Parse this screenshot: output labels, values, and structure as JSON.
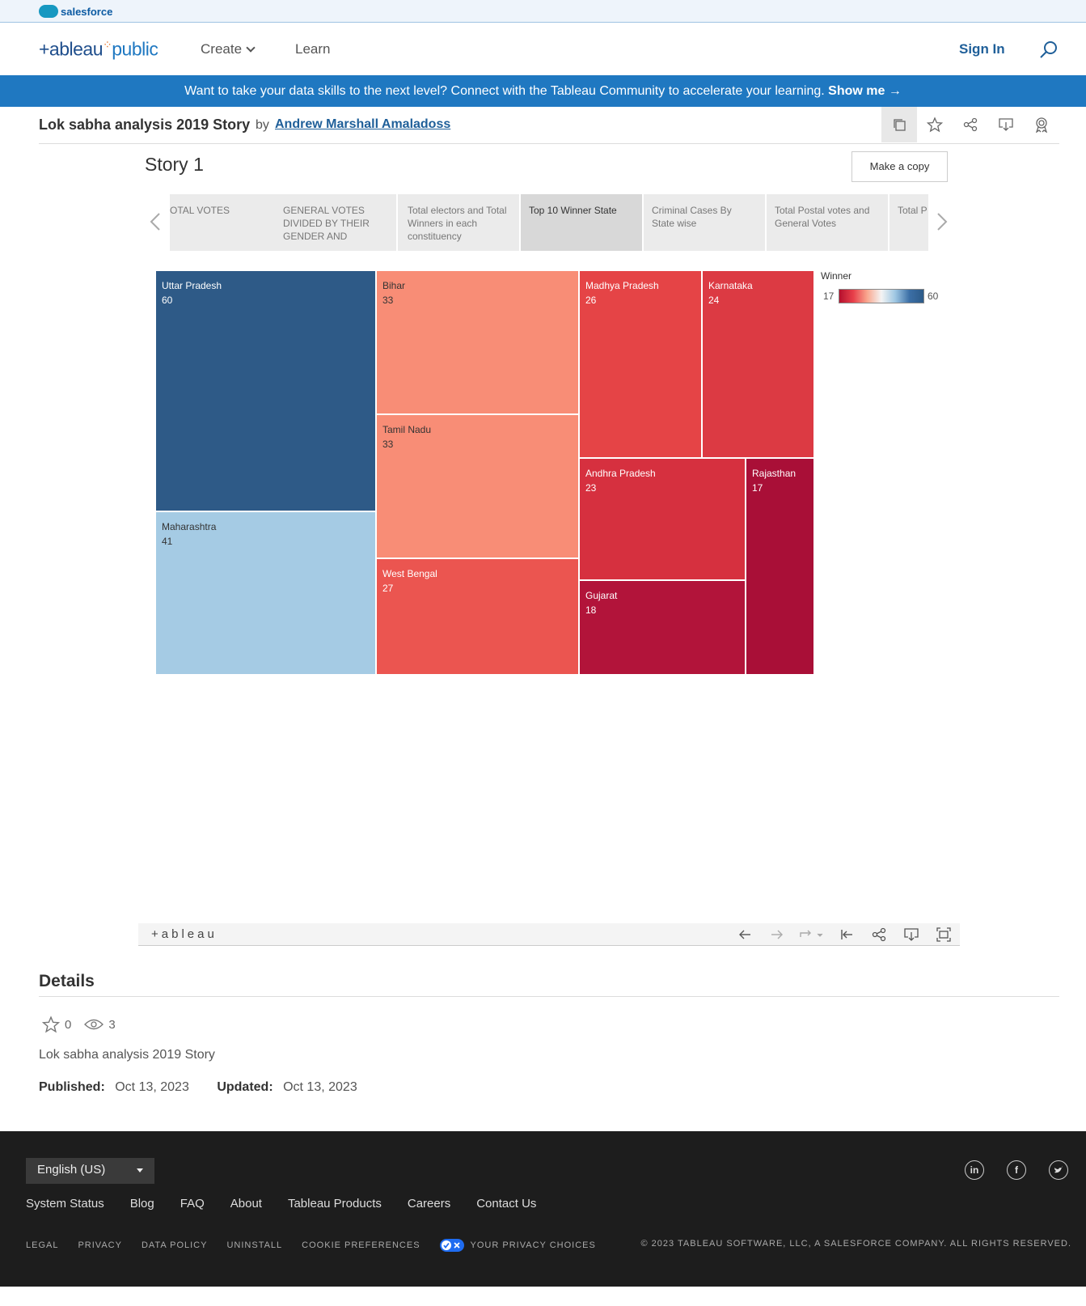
{
  "salesforce": {
    "brand": "salesforce"
  },
  "header": {
    "logo_prefix": "+ableau",
    "logo_suffix": "public",
    "nav": [
      {
        "label": "Create"
      },
      {
        "label": "Learn"
      }
    ],
    "sign_in": "Sign In"
  },
  "banner": {
    "text": "Want to take your data skills to the next level? Connect with the Tableau Community to accelerate your learning.",
    "cta": "Show me →"
  },
  "viz": {
    "title": "Lok sabha analysis 2019 Story",
    "by": "by",
    "author": "Andrew Marshall Amaladoss"
  },
  "story": {
    "title": "Story 1",
    "make_copy": "Make a copy",
    "points": [
      {
        "label": "OTAL VOTES"
      },
      {
        "label": "GENERAL VOTES DIVIDED BY THEIR GENDER AND"
      },
      {
        "label": "Total electors and Total Winners in each constituency"
      },
      {
        "label": "Top 10 Winner State"
      },
      {
        "label": "Criminal Cases By State wise"
      },
      {
        "label": "Total Postal votes and General Votes"
      },
      {
        "label": "Total P each P"
      }
    ]
  },
  "chart_data": {
    "type": "treemap",
    "measure": "Winner",
    "color_range": [
      17,
      60
    ],
    "categories": [
      "Uttar Pradesh",
      "Maharashtra",
      "Bihar",
      "Tamil Nadu",
      "West Bengal",
      "Madhya Pradesh",
      "Karnataka",
      "Andhra Pradesh",
      "Gujarat",
      "Rajasthan"
    ],
    "values": [
      60,
      41,
      33,
      33,
      27,
      26,
      24,
      23,
      18,
      17
    ],
    "colors": {
      "Uttar Pradesh": "#2e5a87",
      "Maharashtra": "#a5cbe4",
      "Bihar": "#f88d76",
      "Tamil Nadu": "#f88d76",
      "West Bengal": "#eb5550",
      "Madhya Pradesh": "#e54446",
      "Karnataka": "#dc3a43",
      "Andhra Pradesh": "#d6303f",
      "Gujarat": "#b2143a",
      "Rajasthan": "#a90f37"
    },
    "legend": {
      "title": "Winner",
      "min": "17",
      "max": "60"
    }
  },
  "details": {
    "heading": "Details",
    "favorites": "0",
    "views": "3",
    "description": "Lok sabha analysis 2019 Story",
    "published_label": "Published:",
    "published": "Oct 13, 2023",
    "updated_label": "Updated:",
    "updated": "Oct 13, 2023"
  },
  "tableau_bar": {
    "logo": "+ableau"
  },
  "footer": {
    "language": "English (US)",
    "links": [
      "System Status",
      "Blog",
      "FAQ",
      "About",
      "Tableau Products",
      "Careers",
      "Contact Us"
    ],
    "legal": [
      "LEGAL",
      "PRIVACY",
      "DATA POLICY",
      "UNINSTALL",
      "COOKIE PREFERENCES"
    ],
    "privacy_choices": "YOUR PRIVACY CHOICES",
    "copyright": "© 2023 TABLEAU SOFTWARE, LLC, A SALESFORCE COMPANY. ALL RIGHTS RESERVED."
  }
}
